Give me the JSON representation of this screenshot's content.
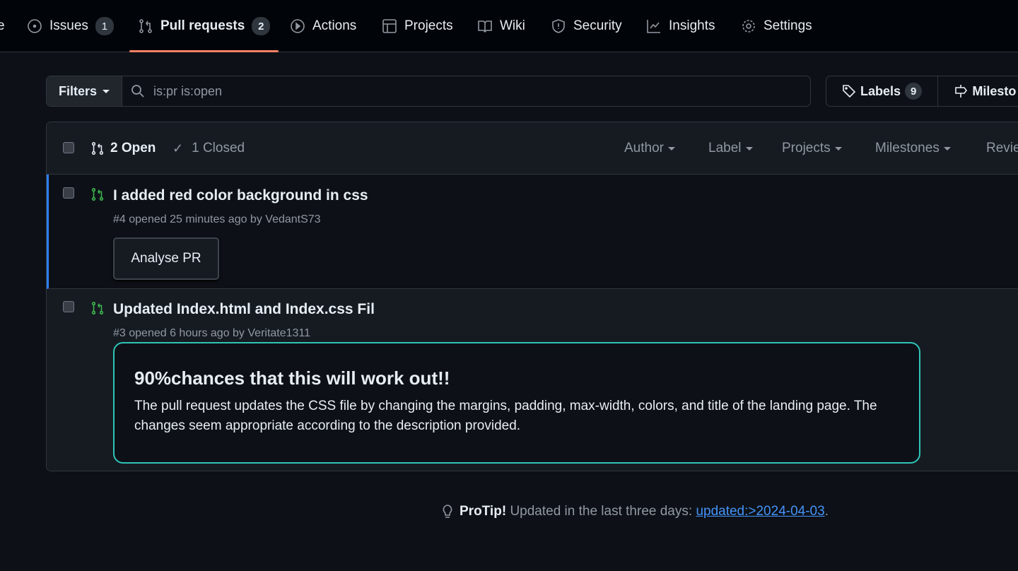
{
  "nav": {
    "tabs": [
      {
        "label": "e",
        "icon": "code-icon"
      },
      {
        "label": "Issues",
        "count": "1",
        "icon": "issue-icon"
      },
      {
        "label": "Pull requests",
        "count": "2",
        "icon": "pull-request-icon",
        "active": true
      },
      {
        "label": "Actions",
        "icon": "play-icon"
      },
      {
        "label": "Projects",
        "icon": "table-icon"
      },
      {
        "label": "Wiki",
        "icon": "book-icon"
      },
      {
        "label": "Security",
        "icon": "shield-icon"
      },
      {
        "label": "Insights",
        "icon": "graph-icon"
      },
      {
        "label": "Settings",
        "icon": "gear-icon"
      }
    ]
  },
  "filters": {
    "label": "Filters",
    "query": "is:pr is:open"
  },
  "labels": {
    "label": "Labels",
    "count": "9"
  },
  "milestones": {
    "label": "Milesto"
  },
  "list": {
    "open": "2 Open",
    "closed": "1 Closed",
    "dropdowns": [
      "Author",
      "Label",
      "Projects",
      "Milestones",
      "Revie"
    ],
    "items": [
      {
        "title": "I added red color background in css",
        "meta": "#4 opened 25 minutes ago by VedantS73",
        "button": "Analyse PR"
      },
      {
        "title": "Updated Index.html and Index.css Fil",
        "meta": "#3 opened 6 hours ago by Veritate1311",
        "analysis": {
          "heading": "90%chances that this will work out!!",
          "body": "The pull request updates the CSS file by changing the margins, padding, max-width, colors, and title of the landing page. The changes seem appropriate according to the description provided."
        }
      }
    ]
  },
  "protip": {
    "label": "ProTip!",
    "text": "Updated in the last three days:",
    "link": "updated:>2024-04-03",
    "end": "."
  },
  "colors": {
    "accent": "#f78166",
    "open": "#3fb950",
    "link": "#4493f8",
    "analysis_border": "#2ec4b6"
  }
}
